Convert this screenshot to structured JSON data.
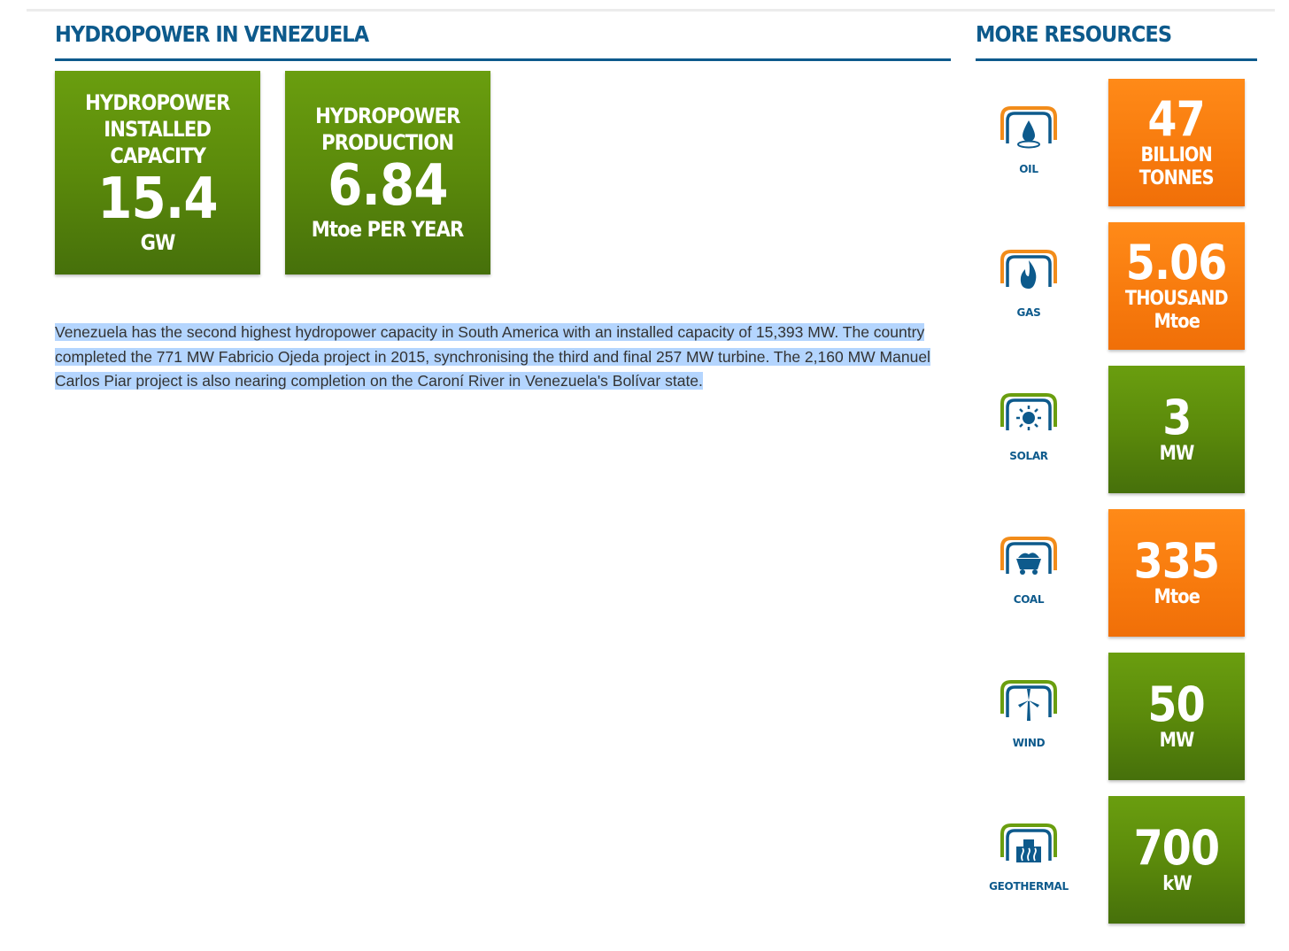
{
  "main": {
    "title": "HYDROPOWER IN VENEZUELA",
    "stats": [
      {
        "label_lines": [
          "HYDROPOWER",
          "INSTALLED",
          "CAPACITY"
        ],
        "value": "15.4",
        "unit": "GW"
      },
      {
        "label_lines": [
          "HYDROPOWER",
          "PRODUCTION"
        ],
        "value": "6.84",
        "unit": "Mtoe PER YEAR"
      }
    ],
    "description": "Venezuela has the second highest hydropower capacity in South America with an installed capacity of 15,393 MW. The country completed the 771 MW Fabricio Ojeda project in 2015, synchronising the third and final 257 MW turbine. The 2,160 MW Manuel Carlos Piar project is also nearing completion on the Caroní River in Venezuela's Bolívar state."
  },
  "sidebar": {
    "title": "MORE RESOURCES",
    "resources": [
      {
        "label": "OIL",
        "icon": "oil-drop-icon",
        "value": "47",
        "unit_lines": [
          "BILLION",
          "TONNES"
        ],
        "color": "orange"
      },
      {
        "label": "GAS",
        "icon": "gas-flame-icon",
        "value": "5.06",
        "unit_lines": [
          "THOUSAND",
          "Mtoe"
        ],
        "color": "orange"
      },
      {
        "label": "SOLAR",
        "icon": "sun-icon",
        "value": "3",
        "unit_lines": [
          "MW"
        ],
        "color": "green"
      },
      {
        "label": "COAL",
        "icon": "coal-cart-icon",
        "value": "335",
        "unit_lines": [
          "Mtoe"
        ],
        "color": "orange"
      },
      {
        "label": "WIND",
        "icon": "wind-turbine-icon",
        "value": "50",
        "unit_lines": [
          "MW"
        ],
        "color": "green"
      },
      {
        "label": "GEOTHERMAL",
        "icon": "geothermal-plant-icon",
        "value": "700",
        "unit_lines": [
          "kW"
        ],
        "color": "green"
      }
    ]
  },
  "colors": {
    "brand_blue": "#0d5a8c",
    "green": "#5b8a0b",
    "orange": "#f77a0d",
    "selection_highlight": "#b4d5fe"
  }
}
